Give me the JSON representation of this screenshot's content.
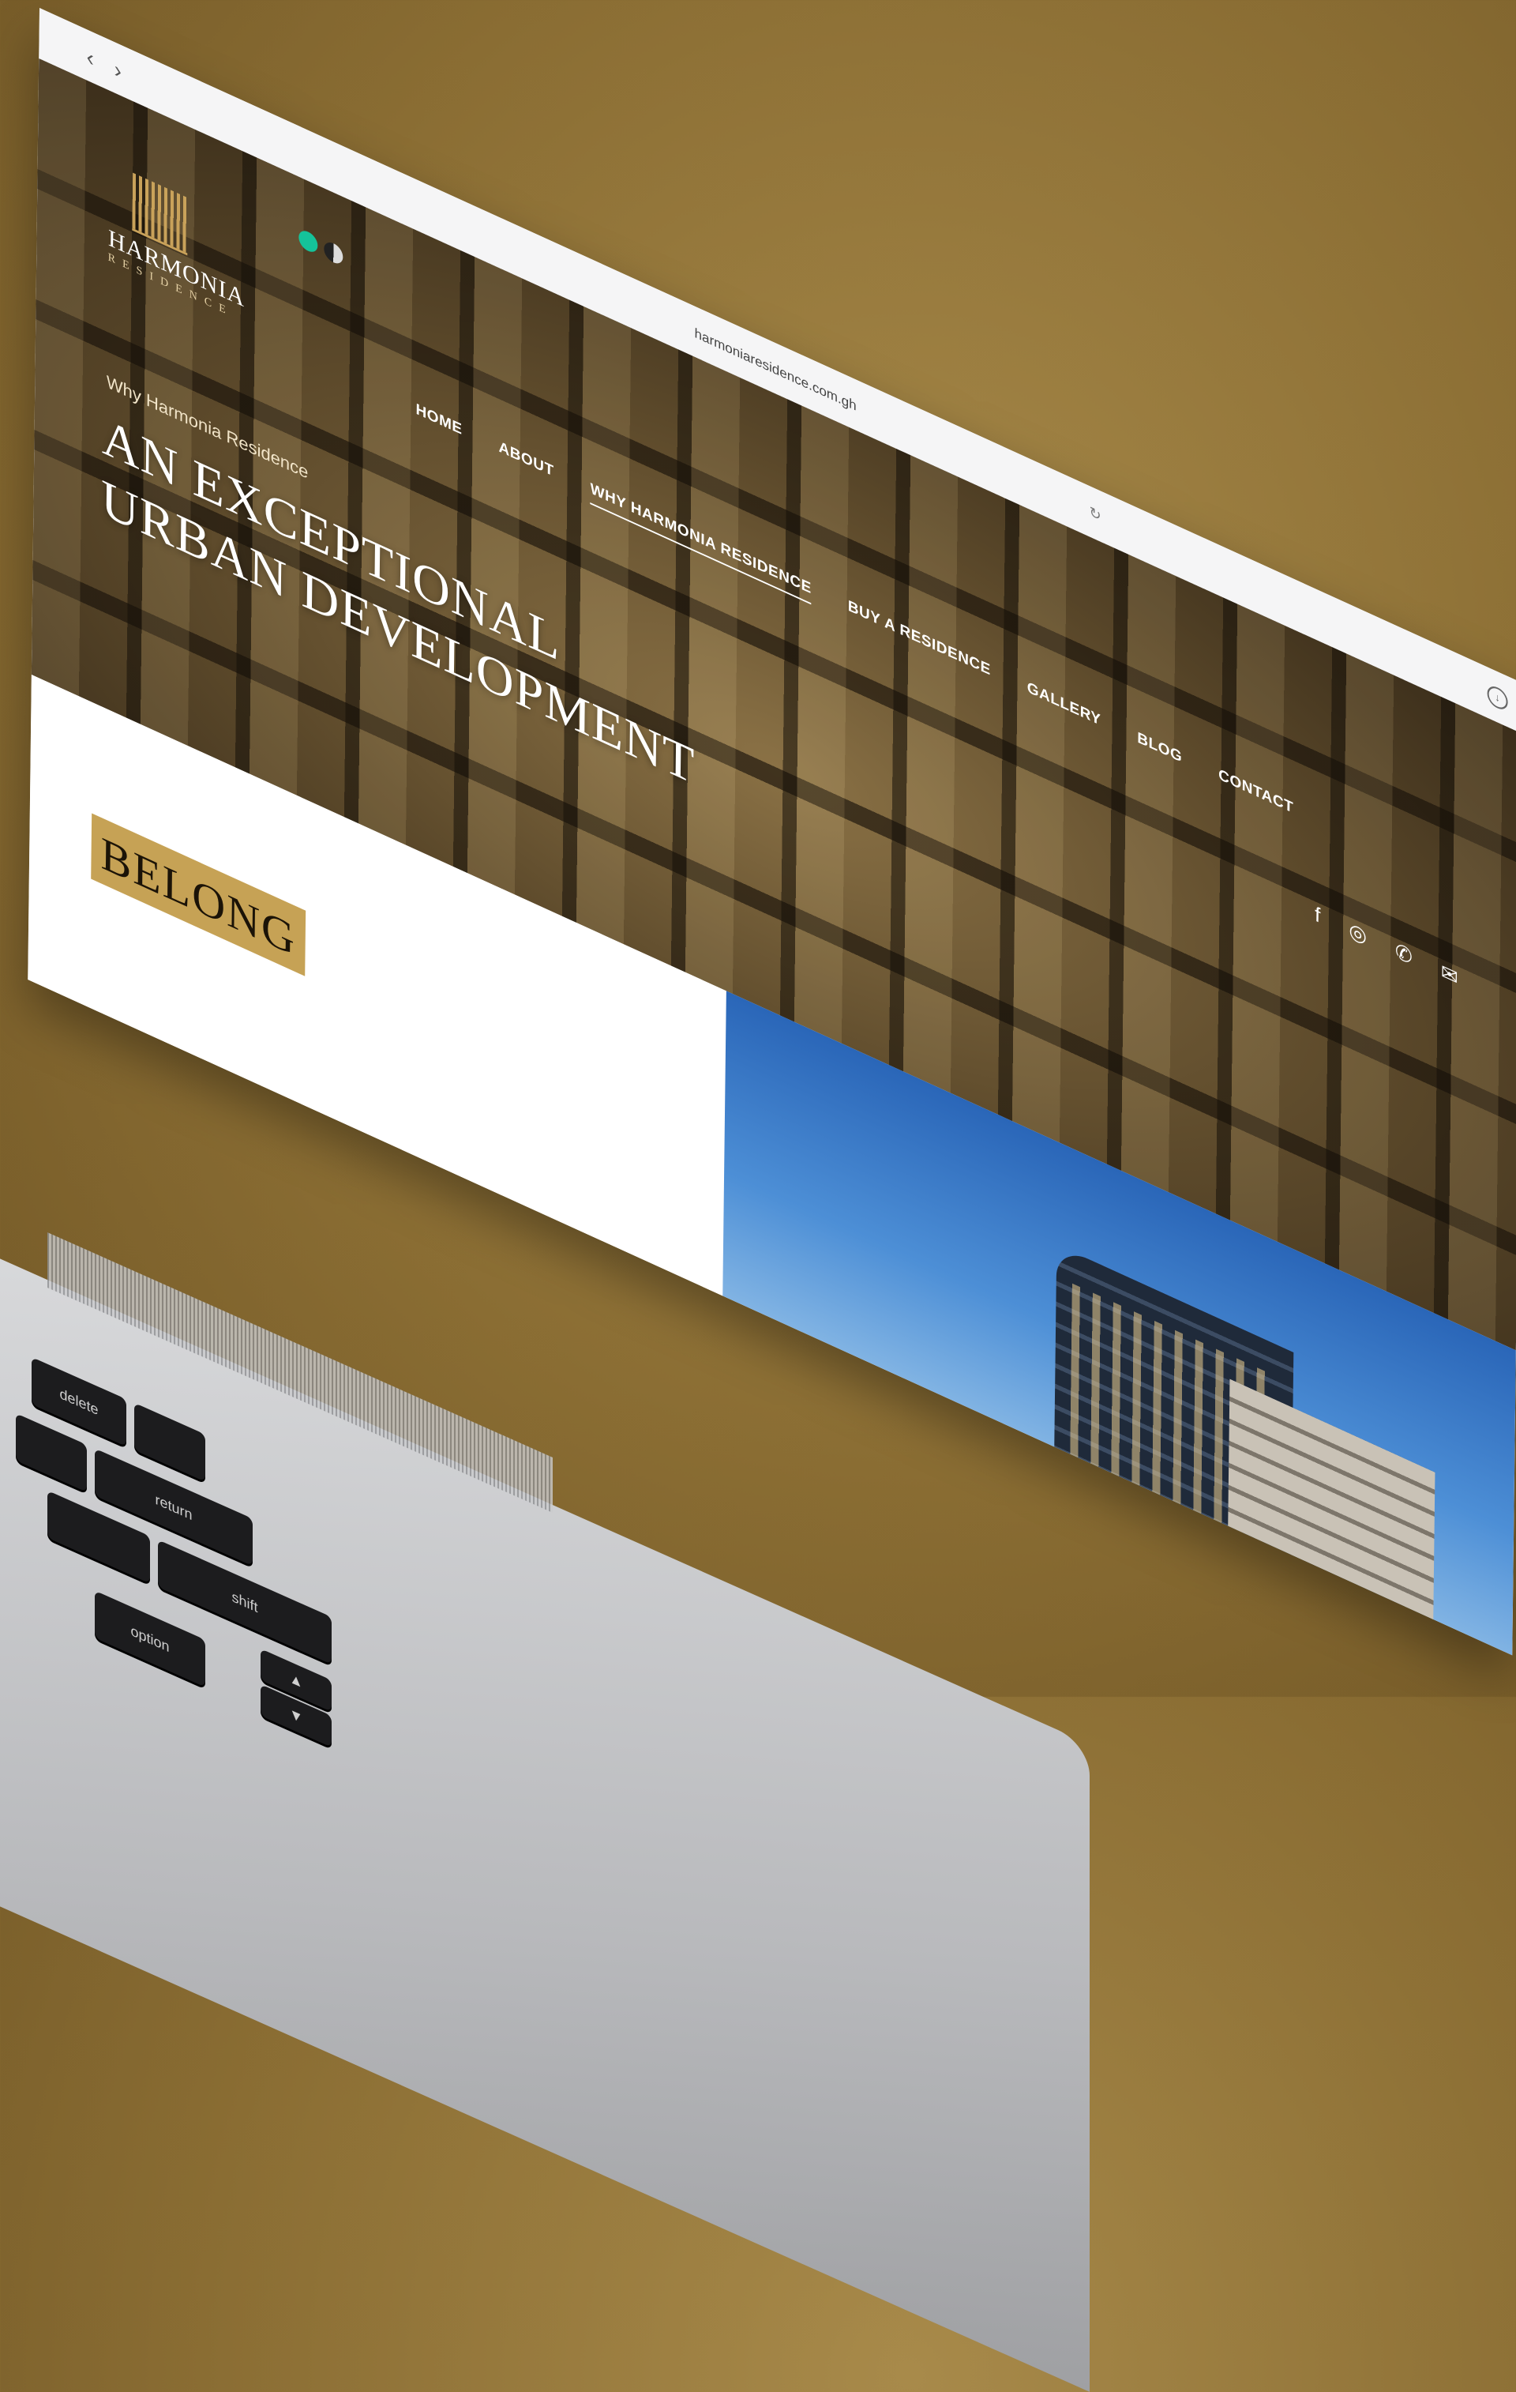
{
  "browser": {
    "url": "harmoniaresidence.com.gh",
    "back_icon": "chevron-left-icon",
    "forward_icon": "chevron-right-icon"
  },
  "logo": {
    "name": "HARMONIA",
    "subtitle": "RESIDENCE"
  },
  "nav": {
    "items": [
      {
        "label": "HOME"
      },
      {
        "label": "ABOUT"
      },
      {
        "label": "WHY HARMONIA RESIDENCE",
        "active": true
      },
      {
        "label": "BUY A RESIDENCE"
      },
      {
        "label": "GALLERY"
      },
      {
        "label": "BLOG"
      },
      {
        "label": "CONTACT"
      }
    ]
  },
  "social": {
    "icons": [
      "facebook-icon",
      "instagram-icon",
      "phone-icon",
      "mail-icon"
    ]
  },
  "hero": {
    "eyebrow": "Why Harmonia Residence",
    "headline_line1": "AN EXCEPTIONAL",
    "headline_line2": "URBAN DEVELOPMENT"
  },
  "section": {
    "belong_label": "BELONG"
  },
  "keyboard": {
    "keys": [
      "delete",
      "return",
      "shift",
      "option"
    ]
  },
  "colors": {
    "background": "#8a6d33",
    "accent_gold": "#c6a255",
    "hero_text": "#ffffff"
  }
}
